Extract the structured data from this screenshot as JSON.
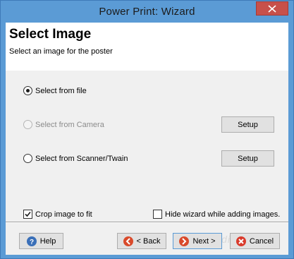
{
  "window": {
    "title": "Power Print: Wizard"
  },
  "header": {
    "title": "Select Image",
    "subtitle": "Select an image for the poster"
  },
  "options": {
    "from_file": "Select from file",
    "from_camera": "Select from Camera",
    "from_scanner": "Select from Scanner/Twain",
    "setup_camera_label": "Setup",
    "setup_scanner_label": "Setup",
    "selected": "from_file"
  },
  "checkboxes": {
    "crop_label": "Crop image to fit",
    "crop_checked": true,
    "hide_wizard_label": "Hide wizard while adding images.",
    "hide_wizard_checked": false
  },
  "buttons": {
    "help": "Help",
    "back": "< Back",
    "next": "Next >",
    "cancel": "Cancel"
  },
  "colors": {
    "titlebar": "#5b9bd5",
    "close": "#c7504a",
    "help_icon": "#3a6fb8",
    "nav_icon": "#d94a2b",
    "cancel_icon": "#d93a2b"
  },
  "icons": {
    "help": "help-icon",
    "back": "back-arrow-icon",
    "next": "next-arrow-icon",
    "cancel": "cancel-x-icon"
  }
}
